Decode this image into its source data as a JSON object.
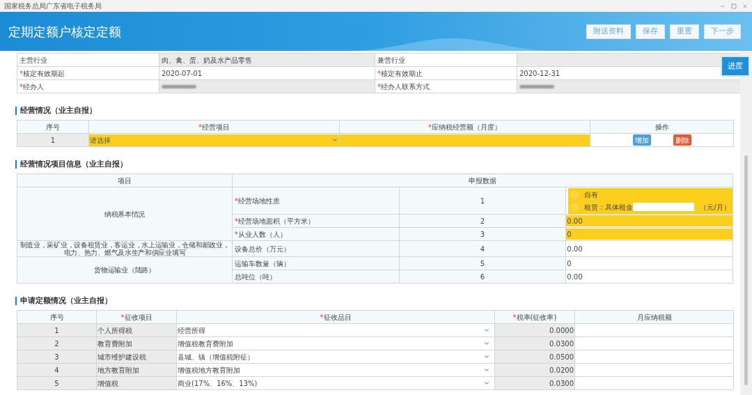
{
  "window": {
    "title": "国家税务总局广东省电子税务局"
  },
  "header": {
    "title": "定期定额户核定定额",
    "buttons": [
      "附送资料",
      "保存",
      "重置",
      "下一步"
    ]
  },
  "progress_button": "进度",
  "info": [
    [
      {
        "label": "主营行业",
        "value": "肉、禽、蛋、奶及水产品零售",
        "readonly": true
      },
      {
        "label": "兼营行业",
        "readonly": true
      }
    ],
    [
      {
        "label": "核定有效期起",
        "mark": "*",
        "value": "2020-07-01",
        "readonly": false
      },
      {
        "label": "核定有效期止",
        "mark": "*",
        "value": "2020-12-31",
        "readonly": false
      }
    ],
    [
      {
        "label": "经办人",
        "mark": "*",
        "redacted": true,
        "readonly": true
      },
      {
        "label": "经办人联系方式",
        "mark": "*",
        "redacted": true,
        "readonly": true
      }
    ]
  ],
  "business": {
    "title": "经营情况（业主自报）",
    "columns": [
      {
        "label": "序号"
      },
      {
        "label": "经营项目",
        "mark": "*"
      },
      {
        "label": "应纳税经营额（月度）",
        "mark": "*"
      },
      {
        "label": "操作"
      }
    ],
    "rows": [
      {
        "seq": "1",
        "project": {
          "placeholder": "请选择"
        },
        "actions": [
          {
            "label": "增加",
            "kind": "add"
          },
          {
            "label": "删除",
            "kind": "delete"
          }
        ]
      }
    ]
  },
  "project_info": {
    "title": "经营情况项目信息（业主自报）",
    "columns": [
      {
        "label": "项目"
      },
      {
        "label": "申报数据"
      }
    ],
    "groups": [
      {
        "label": "纳税基本情况",
        "rows": [
          {
            "label": "经营场地性质",
            "mark": "*",
            "seq": "1",
            "kind": "radio",
            "options": [
              {
                "label": "自有",
                "selected": false
              },
              {
                "label": "租赁：具体租金",
                "selected": false,
                "suffix": "（元/月）"
              }
            ]
          },
          {
            "label": "经营场地面积（平方米）",
            "mark": "*",
            "seq": "2",
            "kind": "input",
            "value": "0.00"
          },
          {
            "label": "从业人数（人）",
            "mark": "*",
            "seq": "3",
            "kind": "input",
            "value": "0"
          }
        ]
      },
      {
        "label": "制造业，采矿业，设备租赁业，客运业，水上运输业，仓储和邮政业，电力、热力、燃气及水生产和供应业填写",
        "rows": [
          {
            "label": "设备总价（万元）",
            "seq": "4",
            "kind": "text",
            "value": "0.00"
          }
        ]
      },
      {
        "label": "货物运输业（陆路）",
        "rows": [
          {
            "label": "运输车数量（辆）",
            "seq": "5",
            "kind": "text",
            "value": "0"
          },
          {
            "label": "总吨位（吨）",
            "seq": "6",
            "kind": "text",
            "value": "0.00"
          }
        ]
      }
    ]
  },
  "quota": {
    "title": "申请定额情况（业主自报）",
    "columns": [
      {
        "label": "序号"
      },
      {
        "label": "征收项目",
        "mark": "*"
      },
      {
        "label": "征收品目",
        "mark": "*"
      },
      {
        "label": "税率(征收率)",
        "mark": "*"
      },
      {
        "label": "月应纳税额"
      }
    ],
    "rows": [
      {
        "seq": "1",
        "item": "个人所得税",
        "subitem": "经营所得",
        "rate": "0.0000"
      },
      {
        "seq": "2",
        "item": "教育费附加",
        "subitem": "增值税教育费附加",
        "rate": "0.0300"
      },
      {
        "seq": "3",
        "item": "城市维护建设税",
        "subitem": "县城、镇（增值税附征）",
        "rate": "0.0500"
      },
      {
        "seq": "4",
        "item": "地方教育附加",
        "subitem": "增值税地方教育附加",
        "rate": "0.0200"
      },
      {
        "seq": "5",
        "item": "增值税",
        "subitem": "商业(17%、16%、13%)",
        "rate": "0.0300"
      }
    ]
  }
}
